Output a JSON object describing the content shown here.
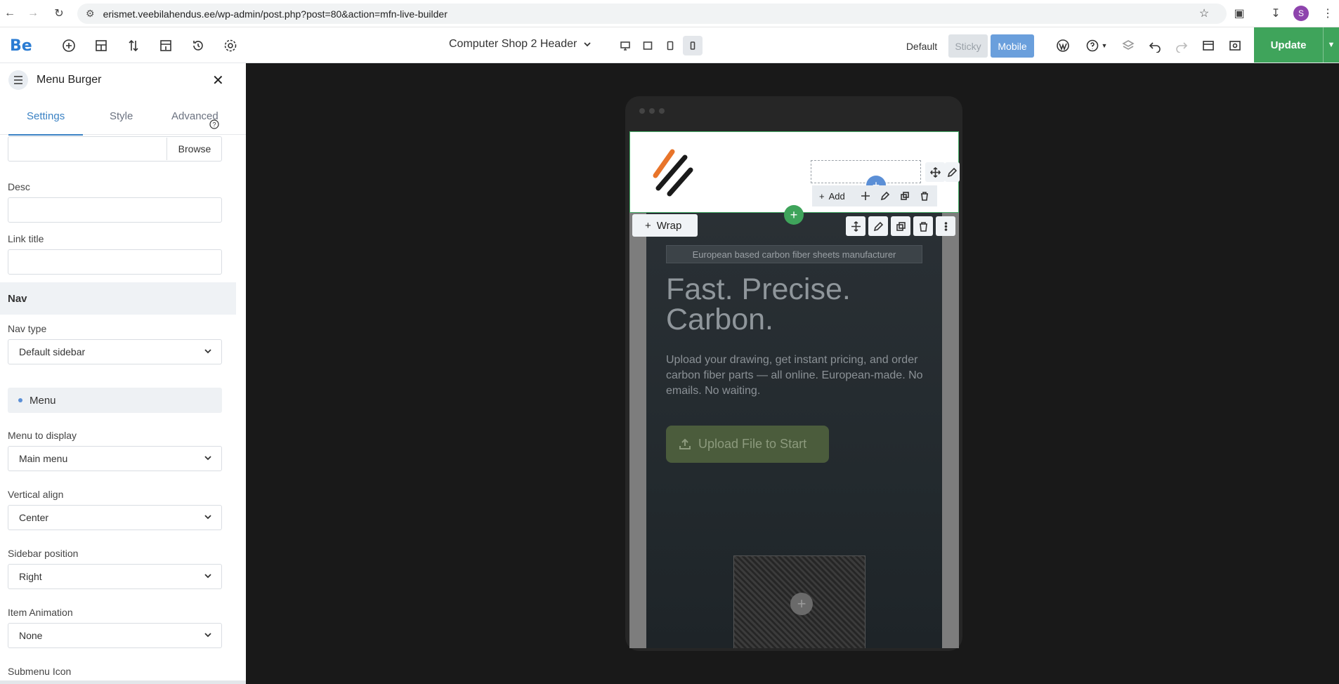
{
  "browser": {
    "url": "erismet.veebilahendus.ee/wp-admin/post.php?post=80&action=mfn-live-builder",
    "profile_initial": "S"
  },
  "topbar": {
    "logo": "Be",
    "page_title": "Computer Shop 2 Header",
    "modes": [
      "Default",
      "Sticky",
      "Mobile"
    ],
    "update_label": "Update"
  },
  "sidebar": {
    "title": "Menu Burger",
    "tabs": [
      "Settings",
      "Style",
      "Advanced"
    ],
    "browse_label": "Browse",
    "desc_label": "Desc",
    "desc_value": "",
    "link_title_label": "Link title",
    "link_title_value": "",
    "nav_section": "Nav",
    "nav_type_label": "Nav type",
    "nav_type_value": "Default sidebar",
    "menu_section": "Menu",
    "menu_to_display_label": "Menu to display",
    "menu_to_display_value": "Main menu",
    "vertical_align_label": "Vertical align",
    "vertical_align_value": "Center",
    "sidebar_position_label": "Sidebar position",
    "sidebar_position_value": "Right",
    "item_animation_label": "Item Animation",
    "item_animation_value": "None",
    "submenu_icon_label": "Submenu Icon"
  },
  "canvas": {
    "wrap_label": "Wrap",
    "add_label": "Add",
    "badge": "European based carbon fiber sheets manufacturer",
    "headline": "Fast. Precise. Carbon.",
    "paragraph": "Upload your drawing, get instant pricing, and order carbon fiber parts — all online. European-made. No emails. No waiting.",
    "cta": "Upload File to Start"
  },
  "colors": {
    "accent_blue": "#5b8fd6",
    "update_green": "#3fa45b",
    "logo_orange": "#e8742a"
  }
}
